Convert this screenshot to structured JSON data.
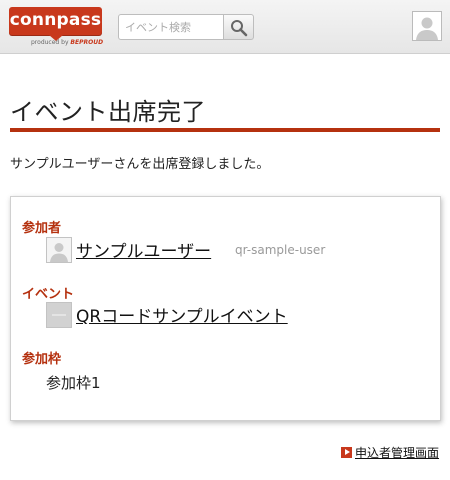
{
  "header": {
    "logo_text": "connpass",
    "logo_sub_prefix": "produced by",
    "logo_sub_brand": "BEPROUD",
    "search_placeholder": "イベント検索"
  },
  "page": {
    "title": "イベント出席完了",
    "message": "サンプルユーザーさんを出席登録しました。"
  },
  "card": {
    "participant_label": "参加者",
    "participant_name": "サンプルユーザー",
    "participant_id": "qr-sample-user",
    "event_label": "イベント",
    "event_name": "QRコードサンプルイベント",
    "frame_label": "参加枠",
    "frame_value": "参加枠1"
  },
  "footer": {
    "admin_link": "申込者管理画面"
  },
  "colors": {
    "brand": "#c8381c",
    "accent_rule": "#b5310f"
  }
}
